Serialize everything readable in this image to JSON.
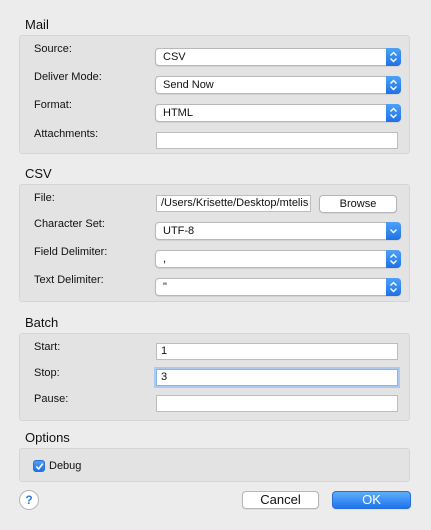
{
  "mail": {
    "title": "Mail",
    "source_label": "Source:",
    "source_value": "CSV",
    "deliver_mode_label": "Deliver Mode:",
    "deliver_mode_value": "Send Now",
    "format_label": "Format:",
    "format_value": "HTML",
    "attachments_label": "Attachments:",
    "attachments_value": ""
  },
  "csv": {
    "title": "CSV",
    "file_label": "File:",
    "file_value": "/Users/Krisette/Desktop/mtelis",
    "browse_label": "Browse",
    "charset_label": "Character Set:",
    "charset_value": "UTF-8",
    "field_delim_label": "Field Delimiter:",
    "field_delim_value": ",",
    "text_delim_label": "Text Delimiter:",
    "text_delim_value": "\""
  },
  "batch": {
    "title": "Batch",
    "start_label": "Start:",
    "start_value": "1",
    "stop_label": "Stop:",
    "stop_value": "3",
    "pause_label": "Pause:",
    "pause_value": ""
  },
  "options": {
    "title": "Options",
    "debug_label": "Debug",
    "debug_checked": true
  },
  "footer": {
    "help_symbol": "?",
    "cancel_label": "Cancel",
    "ok_label": "OK"
  },
  "colors": {
    "accent": "#1e74ee",
    "background": "#ececec",
    "group_background": "#e3e3e3"
  },
  "icons": {
    "popup_arrow": "up-down-chevron-icon",
    "checkbox": "checkmark-icon",
    "help": "question-mark-icon"
  }
}
